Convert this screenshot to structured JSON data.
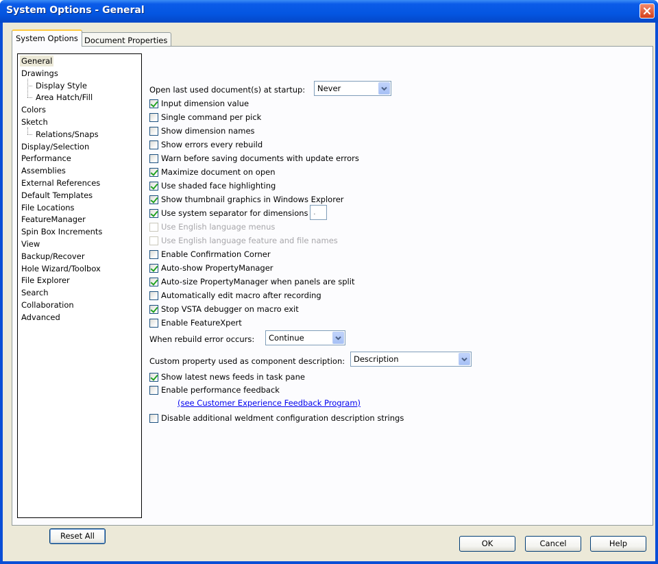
{
  "window": {
    "title": "System Options - General"
  },
  "tabs": [
    {
      "label": "System Options",
      "active": true
    },
    {
      "label": "Document Properties",
      "active": false
    }
  ],
  "tree": {
    "items": [
      {
        "label": "General",
        "level": 0,
        "selected": true
      },
      {
        "label": "Drawings",
        "level": 0
      },
      {
        "label": "Display Style",
        "level": 1
      },
      {
        "label": "Area Hatch/Fill",
        "level": 1
      },
      {
        "label": "Colors",
        "level": 0
      },
      {
        "label": "Sketch",
        "level": 0
      },
      {
        "label": "Relations/Snaps",
        "level": 1
      },
      {
        "label": "Display/Selection",
        "level": 0
      },
      {
        "label": "Performance",
        "level": 0
      },
      {
        "label": "Assemblies",
        "level": 0
      },
      {
        "label": "External References",
        "level": 0
      },
      {
        "label": "Default Templates",
        "level": 0
      },
      {
        "label": "File Locations",
        "level": 0
      },
      {
        "label": "FeatureManager",
        "level": 0
      },
      {
        "label": "Spin Box Increments",
        "level": 0
      },
      {
        "label": "View",
        "level": 0
      },
      {
        "label": "Backup/Recover",
        "level": 0
      },
      {
        "label": "Hole Wizard/Toolbox",
        "level": 0
      },
      {
        "label": "File Explorer",
        "level": 0
      },
      {
        "label": "Search",
        "level": 0
      },
      {
        "label": "Collaboration",
        "level": 0
      },
      {
        "label": "Advanced",
        "level": 0
      }
    ]
  },
  "reset_label": "Reset All",
  "general": {
    "open_last_label": "Open last used document(s) at startup:",
    "open_last_value": "Never",
    "options": [
      {
        "label": "Input dimension value",
        "checked": true,
        "enabled": true
      },
      {
        "label": "Single command per pick",
        "checked": false,
        "enabled": true
      },
      {
        "label": "Show dimension names",
        "checked": false,
        "enabled": true
      },
      {
        "label": "Show errors every rebuild",
        "checked": false,
        "enabled": true
      },
      {
        "label": "Warn before saving documents with update errors",
        "checked": false,
        "enabled": true
      },
      {
        "label": "Maximize document on open",
        "checked": true,
        "enabled": true
      },
      {
        "label": "Use shaded face highlighting",
        "checked": true,
        "enabled": true
      },
      {
        "label": "Show thumbnail graphics in Windows Explorer",
        "checked": true,
        "enabled": true
      },
      {
        "label": "Use system separator for dimensions",
        "checked": true,
        "enabled": true
      },
      {
        "label": "Use English language menus",
        "checked": false,
        "enabled": false
      },
      {
        "label": "Use English language feature and file names",
        "checked": false,
        "enabled": false
      },
      {
        "label": "Enable Confirmation Corner",
        "checked": false,
        "enabled": true
      },
      {
        "label": "Auto-show PropertyManager",
        "checked": true,
        "enabled": true
      },
      {
        "label": "Auto-size PropertyManager when panels are split",
        "checked": true,
        "enabled": true
      },
      {
        "label": "Automatically edit macro after recording",
        "checked": false,
        "enabled": true
      },
      {
        "label": "Stop VSTA debugger on macro exit",
        "checked": true,
        "enabled": true
      },
      {
        "label": "Enable FeatureXpert",
        "checked": false,
        "enabled": true
      }
    ],
    "separator_value": ".",
    "rebuild_error_label": "When rebuild error occurs:",
    "rebuild_error_value": "Continue",
    "custom_prop_label": "Custom property used as component description:",
    "custom_prop_value": "Description",
    "news_feeds_label": "Show latest news feeds in task pane",
    "news_feeds_checked": true,
    "perf_feedback_label": "Enable performance feedback",
    "perf_feedback_checked": false,
    "feedback_link": "(see Customer Experience Feedback Program)",
    "weldment_label": "Disable additional weldment configuration description strings",
    "weldment_checked": false
  },
  "buttons": {
    "ok": "OK",
    "cancel": "Cancel",
    "help": "Help"
  }
}
